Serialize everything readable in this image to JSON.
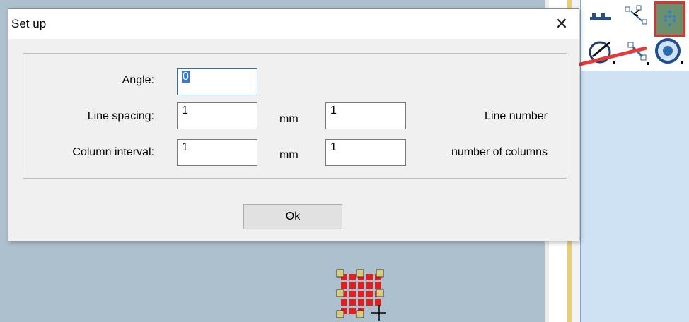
{
  "dialog": {
    "title": "Set up",
    "close_symbol": "✕",
    "fields": {
      "angle": {
        "label": "Angle:",
        "value": "0"
      },
      "line_spacing": {
        "label": "Line spacing:",
        "value": "1",
        "unit": "mm"
      },
      "line_number": {
        "label": "Line number",
        "value": "1"
      },
      "column_interval": {
        "label": "Column interval:",
        "value": "1",
        "unit": "mm"
      },
      "number_of_columns": {
        "label": "number of columns",
        "value": "1"
      }
    },
    "ok_label": "Ok"
  },
  "toolbar": {
    "tools": [
      "shapes-tool-icon",
      "node-edit-icon",
      "array-tool-icon",
      "pen-tool-icon",
      "node-select-icon",
      "circle-tool-icon"
    ],
    "highlight_color": "#e03030"
  },
  "colors": {
    "canvas": "#adc0cd",
    "panel": "#cfe2f3",
    "array_fill": "#e02020",
    "array_handles": "#d8cc7a"
  }
}
